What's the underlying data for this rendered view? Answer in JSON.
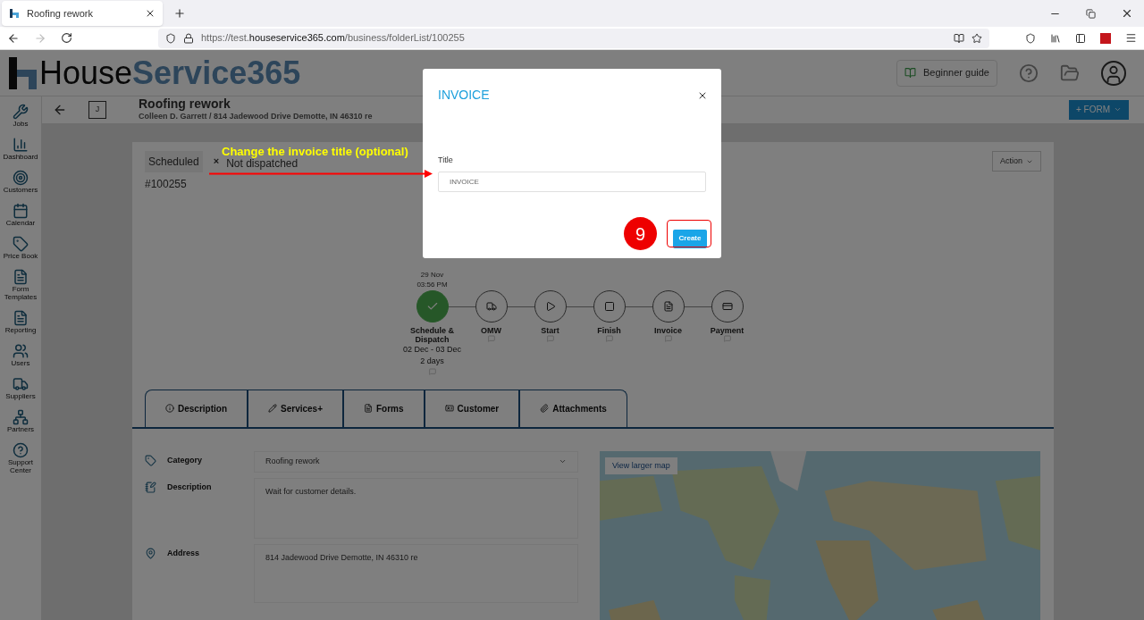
{
  "browser": {
    "tab_title": "Roofing rework",
    "url_prefix": "https://test.",
    "url_domain": "houseservice365.com",
    "url_path": "/business/folderList/100255"
  },
  "app_header": {
    "logo_dark": "House",
    "logo_light": "Service365",
    "guide": "Beginner guide"
  },
  "sidebar": [
    {
      "kind": "jobs",
      "label": "Jobs"
    },
    {
      "kind": "dashboard",
      "label": "Dashboard"
    },
    {
      "kind": "customers",
      "label": "Customers"
    },
    {
      "kind": "calendar",
      "label": "Calendar"
    },
    {
      "kind": "pricebook",
      "label": "Price Book"
    },
    {
      "kind": "forms",
      "label": "Form Templates"
    },
    {
      "kind": "reporting",
      "label": "Reporting"
    },
    {
      "kind": "users",
      "label": "Users"
    },
    {
      "kind": "suppliers",
      "label": "Suppliers"
    },
    {
      "kind": "partners",
      "label": "Partners"
    },
    {
      "kind": "support",
      "label": "Support Center"
    }
  ],
  "job": {
    "badge": "J",
    "title": "Roofing rework",
    "subtitle": "Colleen D. Garrett / 814 Jadewood Drive Demotte, IN 46310 re",
    "form_button": "+ FORM",
    "status": "Scheduled",
    "dispatch": "Not dispatched",
    "dispatch_mark": "×",
    "number": "#100255",
    "action": "Action"
  },
  "steps": [
    {
      "kind": "schedule",
      "label": "Schedule & Dispatch",
      "done": true,
      "date": "29 Nov",
      "time": "03:56 PM",
      "range": "02 Dec - 03 Dec",
      "duration": "2 days"
    },
    {
      "kind": "omw",
      "label": "OMW",
      "done": false
    },
    {
      "kind": "start",
      "label": "Start",
      "done": false
    },
    {
      "kind": "finish",
      "label": "Finish",
      "done": false
    },
    {
      "kind": "invoice",
      "label": "Invoice",
      "done": false
    },
    {
      "kind": "payment",
      "label": "Payment",
      "done": false
    }
  ],
  "tabs": [
    {
      "kind": "info",
      "label": "Description",
      "selected": false
    },
    {
      "kind": "services",
      "label": "Services+",
      "selected": false
    },
    {
      "kind": "forms",
      "label": "Forms",
      "selected": false
    },
    {
      "kind": "customer",
      "label": "Customer",
      "selected": false
    },
    {
      "kind": "attachments",
      "label": "Attachments",
      "selected": false
    }
  ],
  "fields": [
    {
      "kind": "select",
      "label": "Category",
      "value": "Roofing rework"
    },
    {
      "kind": "textarea",
      "label": "Description",
      "value": "Wait for customer details."
    },
    {
      "kind": "address",
      "label": "Address",
      "value": "814 Jadewood Drive Demotte, IN 46310 re"
    }
  ],
  "map": {
    "button": "View larger map"
  },
  "dialog": {
    "title": "INVOICE",
    "field_label": "Title",
    "field_placeholder": "INVOICE",
    "create": "Create"
  },
  "annotation": {
    "text": "Change the invoice title (optional)",
    "step": "9"
  }
}
